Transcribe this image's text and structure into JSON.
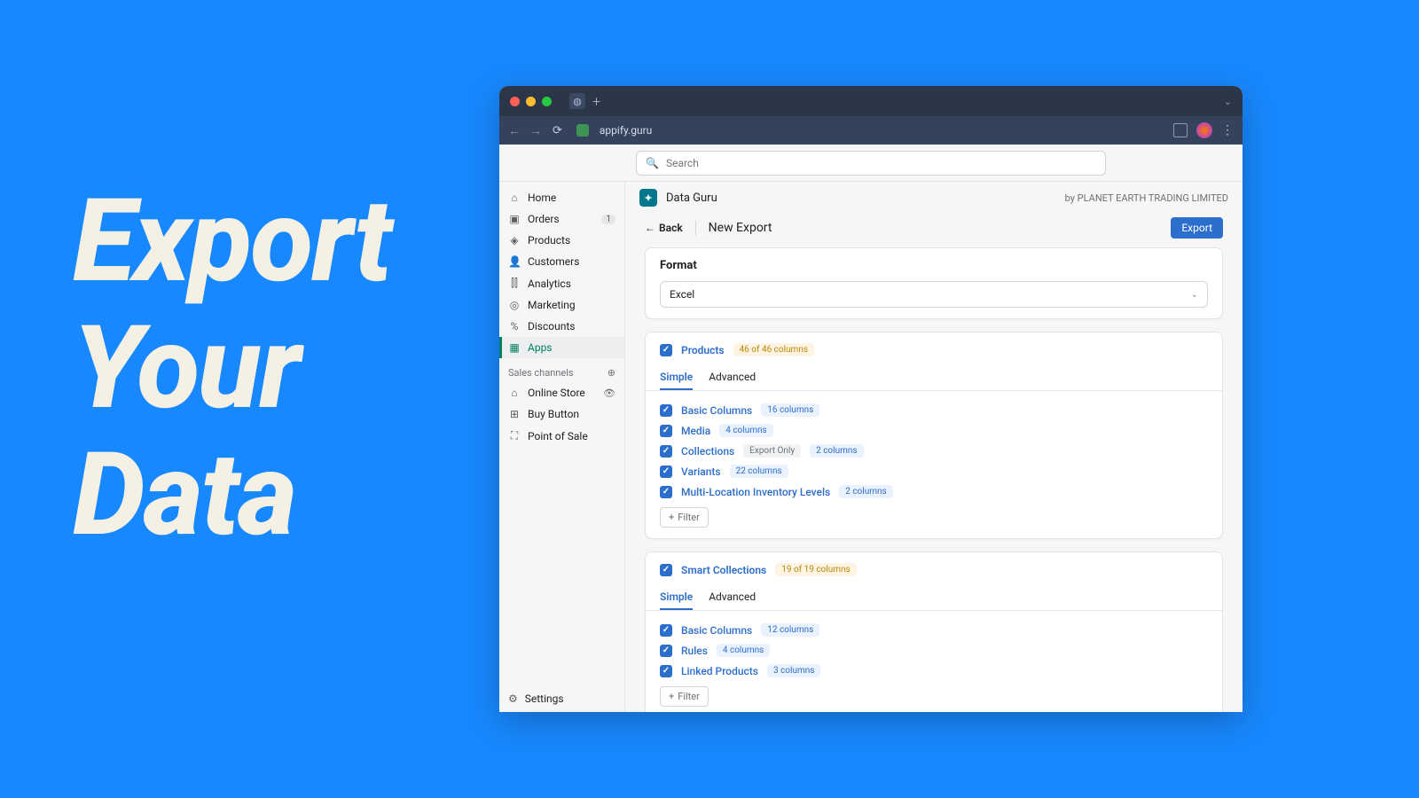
{
  "hero": {
    "line1": "Export",
    "line2": "Your",
    "line3": "Data"
  },
  "browser": {
    "url": "appify.guru"
  },
  "search": {
    "placeholder": "Search"
  },
  "sidebar": {
    "items": [
      {
        "icon": "home-icon",
        "glyph": "⌂",
        "label": "Home"
      },
      {
        "icon": "orders-icon",
        "glyph": "▣",
        "label": "Orders",
        "badge": "1"
      },
      {
        "icon": "products-icon",
        "glyph": "◈",
        "label": "Products"
      },
      {
        "icon": "customers-icon",
        "glyph": "👤",
        "label": "Customers"
      },
      {
        "icon": "analytics-icon",
        "glyph": "⫿⫿",
        "label": "Analytics"
      },
      {
        "icon": "marketing-icon",
        "glyph": "◎",
        "label": "Marketing"
      },
      {
        "icon": "discounts-icon",
        "glyph": "%",
        "label": "Discounts"
      },
      {
        "icon": "apps-icon",
        "glyph": "▦",
        "label": "Apps"
      }
    ],
    "section_label": "Sales channels",
    "channels": [
      {
        "icon": "store-icon",
        "glyph": "⌂",
        "label": "Online Store",
        "eye": true
      },
      {
        "icon": "buy-button-icon",
        "glyph": "⊞",
        "label": "Buy Button"
      },
      {
        "icon": "pos-icon",
        "glyph": "⛶",
        "label": "Point of Sale"
      }
    ],
    "settings_label": "Settings"
  },
  "app": {
    "name": "Data Guru",
    "vendor": "by PLANET EARTH TRADING LIMITED"
  },
  "page": {
    "back": "Back",
    "title": "New Export",
    "export_btn": "Export"
  },
  "format": {
    "heading": "Format",
    "selected": "Excel"
  },
  "tabs": {
    "simple": "Simple",
    "advanced": "Advanced"
  },
  "filter_label": "Filter",
  "blocks": [
    {
      "name": "Products",
      "count_pill": "46 of 46 columns",
      "rows": [
        {
          "label": "Basic Columns",
          "pills": [
            {
              "text": "16 columns",
              "style": "blue"
            }
          ]
        },
        {
          "label": "Media",
          "pills": [
            {
              "text": "4 columns",
              "style": "blue"
            }
          ]
        },
        {
          "label": "Collections",
          "pills": [
            {
              "text": "Export Only",
              "style": "gray"
            },
            {
              "text": "2 columns",
              "style": "blue"
            }
          ]
        },
        {
          "label": "Variants",
          "pills": [
            {
              "text": "22 columns",
              "style": "blue"
            }
          ]
        },
        {
          "label": "Multi-Location Inventory Levels",
          "pills": [
            {
              "text": "2 columns",
              "style": "blue"
            }
          ]
        }
      ]
    },
    {
      "name": "Smart Collections",
      "count_pill": "19 of 19 columns",
      "rows": [
        {
          "label": "Basic Columns",
          "pills": [
            {
              "text": "12 columns",
              "style": "blue"
            }
          ]
        },
        {
          "label": "Rules",
          "pills": [
            {
              "text": "4 columns",
              "style": "blue"
            }
          ]
        },
        {
          "label": "Linked Products",
          "pills": [
            {
              "text": "3 columns",
              "style": "blue"
            }
          ]
        }
      ]
    }
  ]
}
